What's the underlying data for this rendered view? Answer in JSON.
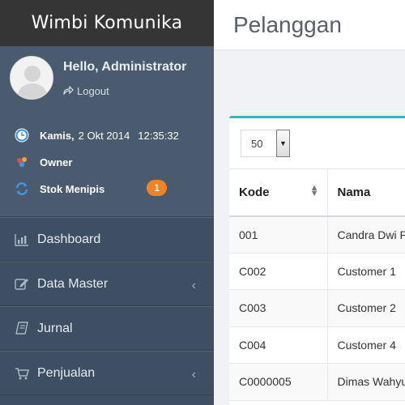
{
  "brand": "Wimbi Komunika",
  "user": {
    "greeting": "Hello, Administrator",
    "logout_label": "Logout"
  },
  "info": {
    "day": "Kamis,",
    "date": "2 Okt 2014",
    "time": "12:35:32",
    "role": "Owner",
    "stock_label": "Stok Menipis",
    "stock_count": "1"
  },
  "menu": [
    {
      "label": "Dashboard",
      "icon": "bar-chart-icon",
      "has_submenu": false
    },
    {
      "label": "Data Master",
      "icon": "edit-icon",
      "has_submenu": true
    },
    {
      "label": "Jurnal",
      "icon": "book-icon",
      "has_submenu": false
    },
    {
      "label": "Penjualan",
      "icon": "cart-icon",
      "has_submenu": true
    }
  ],
  "page": {
    "title": "Pelanggan"
  },
  "table": {
    "page_length": "50",
    "columns": [
      "Kode",
      "Nama"
    ],
    "rows": [
      {
        "kode": "001",
        "nama": "Candra Dwi P"
      },
      {
        "kode": "C002",
        "nama": "Customer 1"
      },
      {
        "kode": "C003",
        "nama": "Customer 2"
      },
      {
        "kode": "C004",
        "nama": "Customer 4"
      },
      {
        "kode": "C0000005",
        "nama": "Dimas Wahyu"
      }
    ]
  },
  "colors": {
    "sidebar": "#3e4f63",
    "brand_bar": "#353535",
    "accent": "#30b7c8",
    "badge": "#f58220"
  }
}
